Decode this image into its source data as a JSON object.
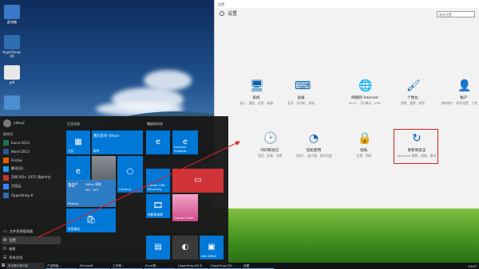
{
  "desktop": {
    "icons": [
      {
        "label": "此电脑",
        "color": "#3a79c8"
      },
      {
        "label": "HyperSnap-DX",
        "color": "#2d6fb0"
      },
      {
        "label": "pdf",
        "color": "#e8e8e8"
      },
      {
        "label": "",
        "color": "#4a8fd0"
      }
    ]
  },
  "settings": {
    "window_title": "设置",
    "header": "设置",
    "search_placeholder": "查找设置",
    "items": [
      {
        "title": "系统",
        "subtitle": "显示、通知、应用、电源",
        "icon": "laptop-icon",
        "glyph": "🖥"
      },
      {
        "title": "设备",
        "subtitle": "蓝牙、打印机、鼠标",
        "icon": "keyboard-icon",
        "glyph": "⌨"
      },
      {
        "title": "网络和 Internet",
        "subtitle": "Wi-Fi、飞行模式、VPN",
        "icon": "globe-icon",
        "glyph": "🌐"
      },
      {
        "title": "个性化",
        "subtitle": "背景、锁屏、颜色",
        "icon": "paint-icon",
        "glyph": "🖌"
      },
      {
        "title": "帐户",
        "subtitle": "你的帐户、同步设置、工作、家庭",
        "icon": "person-icon",
        "glyph": "👤"
      },
      {
        "title": "时间和语言",
        "subtitle": "语音、区域、日期",
        "icon": "clock-language-icon",
        "glyph": "🕑"
      },
      {
        "title": "轻松使用",
        "subtitle": "讲述人、放大镜、高对比度",
        "icon": "ease-of-access-icon",
        "glyph": "◔"
      },
      {
        "title": "隐私",
        "subtitle": "位置、相机",
        "icon": "lock-icon",
        "glyph": "🔒"
      },
      {
        "title": "更新和安全",
        "subtitle": "Windows 更新、恢复、备份",
        "icon": "refresh-icon",
        "glyph": "↻"
      }
    ]
  },
  "start_menu": {
    "user_name": "cdha2",
    "most_used_label": "最常用",
    "recent_label": "最近添加",
    "apps": [
      {
        "name": "Excel 2013",
        "color": "#1e7145"
      },
      {
        "name": "Word 2013",
        "color": "#2b579a"
      },
      {
        "name": "Firefox",
        "color": "#e66000"
      },
      {
        "name": "腾讯QQ",
        "color": "#1d9bf0"
      },
      {
        "name": "ZWCAD+ 2015 简体中文",
        "color": "#c0392b"
      },
      {
        "name": "百度云",
        "color": "#3385ff"
      },
      {
        "name": "HyperSnap 8",
        "color": "#2d6fb0"
      }
    ],
    "bottom": [
      {
        "name": "文件资源管理器",
        "icon": "folder-icon",
        "active": false
      },
      {
        "name": "设置",
        "icon": "gear-icon",
        "active": true
      },
      {
        "name": "电源",
        "icon": "power-icon",
        "active": false
      },
      {
        "name": "所有应用",
        "icon": "list-icon",
        "active": false
      }
    ],
    "group1_title": "生活动态",
    "group2_title": "播放和浏览",
    "tiles": {
      "calendar": "日历",
      "mail": "我们支持 Yahoo",
      "mail_sub": "邮件",
      "edge": "Microsoft Edge",
      "photos": "照片",
      "cortana": "Cortana",
      "weather_temp": "90°",
      "weather_high": "90°",
      "weather_low": "80°",
      "weather_city": "Beijing",
      "weather_title": "Office 获取",
      "store": "应用商店",
      "ie": "Internet Explorer",
      "recovery": "Create USB Recovery",
      "movies": "电影和电视",
      "game": "Candy Crush",
      "calc": "计算器",
      "onenote": "OneNote",
      "getoffice": "Get Office"
    }
  },
  "taskbar": {
    "search_text": "有问题尽管问我",
    "items": [
      "产品搜索...",
      "Microsoft",
      "工作簿...",
      "Excel表...",
      "HyperSnap-DX 8",
      "HyperSnap-DX...",
      "设置"
    ],
    "clock": "14:47"
  }
}
